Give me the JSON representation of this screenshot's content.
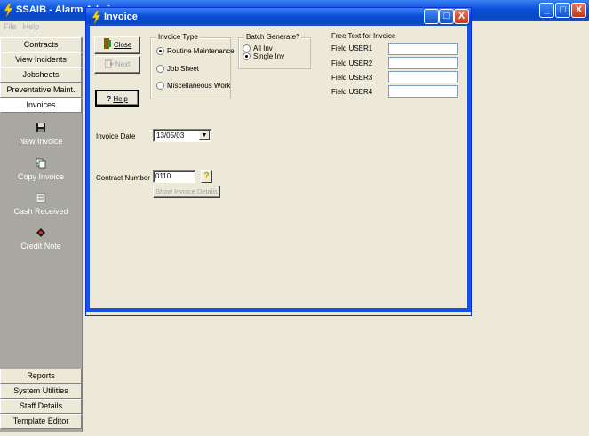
{
  "app": {
    "title": "SSAIB - Alarm Admi",
    "window_buttons": {
      "minimize": "_",
      "maximize": "□",
      "close": "X"
    }
  },
  "menu": {
    "items": [
      "File",
      "Help"
    ]
  },
  "nav": {
    "top_buttons": [
      "Contracts",
      "View Incidents",
      "Jobsheets",
      "Preventative Maint.",
      "Invoices"
    ],
    "active": "Invoices",
    "panel_items": [
      {
        "label": "New Invoice",
        "icon": "save-icon"
      },
      {
        "label": "Copy Invoice",
        "icon": "copy-document-icon"
      },
      {
        "label": "Cash Received",
        "icon": "cash-register-icon"
      },
      {
        "label": "Credit Note",
        "icon": "credit-note-icon"
      }
    ],
    "bottom_buttons": [
      "Reports",
      "System Utilities",
      "Staff Details",
      "Template Editor"
    ]
  },
  "invoice_window": {
    "title": "Invoice",
    "buttons": {
      "close": "Close",
      "next": "Next",
      "help": "Help"
    },
    "invoice_type": {
      "label": "Invoice Type",
      "options": [
        "Routine Maintenance",
        "Job Sheet",
        "Miscellaneous Work"
      ],
      "selected": "Routine Maintenance"
    },
    "batch_generate": {
      "label": "Batch Generate?",
      "options": [
        "All Inv",
        "Single Inv"
      ],
      "selected": "Single Inv"
    },
    "free_text": {
      "label": "Free Text for Invoice",
      "fields": [
        {
          "label": "Field USER1",
          "value": ""
        },
        {
          "label": "Field USER2",
          "value": ""
        },
        {
          "label": "Field USER3",
          "value": ""
        },
        {
          "label": "Field USER4",
          "value": ""
        }
      ]
    },
    "invoice_date": {
      "label": "Invoice Date",
      "value": "13/05/03"
    },
    "contract_number": {
      "label": "Contract Number",
      "value": "0110",
      "lookup_label": "?"
    },
    "show_details_button": "Show Invoice Details"
  },
  "colors": {
    "titlebar": "#0a4fd8",
    "nav_panel": "#a8a8a0",
    "face": "#ece9d8"
  }
}
